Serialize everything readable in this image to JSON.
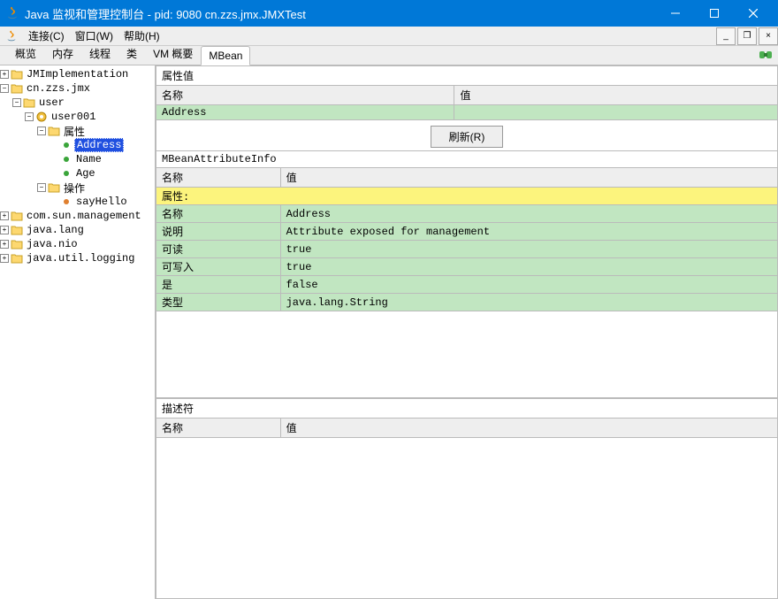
{
  "title": "Java 监视和管理控制台 - pid: 9080 cn.zzs.jmx.JMXTest",
  "menu": {
    "connect": "连接(C)",
    "window": "窗口(W)",
    "help": "帮助(H)"
  },
  "tabs": {
    "overview": "概览",
    "memory": "内存",
    "threads": "线程",
    "classes": "类",
    "vm": "VM 概要",
    "mbean": "MBean"
  },
  "tree": {
    "jmi": "JMImplementation",
    "cn": "cn.zzs.jmx",
    "user": "user",
    "user001": "user001",
    "attrs": "属性",
    "address": "Address",
    "name": "Name",
    "age": "Age",
    "ops": "操作",
    "sayHello": "sayHello",
    "comsun": "com.sun.management",
    "javalang": "java.lang",
    "javanio": "java.nio",
    "javalog": "java.util.logging"
  },
  "attr_value": {
    "title": "属性值",
    "col_name": "名称",
    "col_value": "值",
    "row_name": "Address",
    "row_value": "",
    "refresh": "刷新(R)"
  },
  "attr_info": {
    "title": "MBeanAttributeInfo",
    "col_name": "名称",
    "col_value": "值",
    "rows": {
      "group": "属性:",
      "name_k": "名称",
      "name_v": "Address",
      "desc_k": "说明",
      "desc_v": "Attribute exposed for management",
      "read_k": "可读",
      "read_v": "true",
      "write_k": "可写入",
      "write_v": "true",
      "is_k": "是",
      "is_v": "false",
      "type_k": "类型",
      "type_v": "java.lang.String"
    }
  },
  "descriptor": {
    "title": "描述符",
    "col_name": "名称",
    "col_value": "值"
  }
}
